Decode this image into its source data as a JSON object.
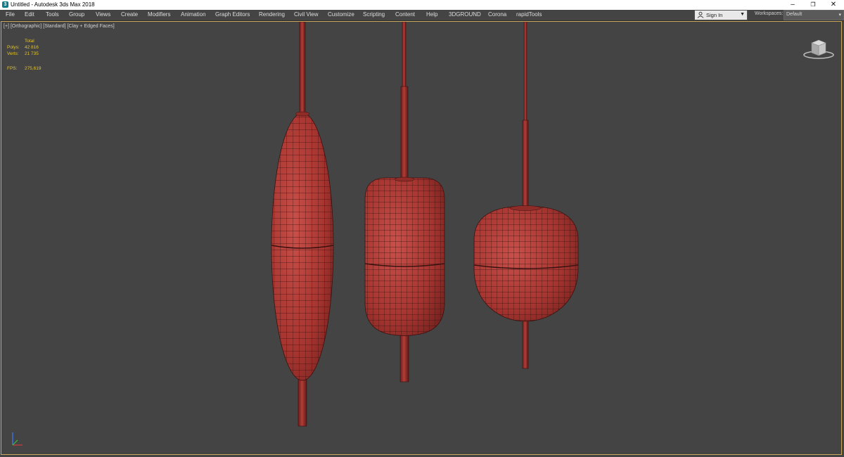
{
  "window": {
    "title": "Untitled - Autodesk 3ds Max 2018",
    "minimize_glyph": "–",
    "maximize_glyph": "❐",
    "close_glyph": "✕"
  },
  "menu": {
    "items": [
      "File",
      "Edit",
      "Tools",
      "Group",
      "Views",
      "Create",
      "Modifiers",
      "Animation",
      "Graph Editors",
      "Rendering",
      "Civil View",
      "Customize",
      "Scripting",
      "Content",
      "Help",
      "3DGROUND",
      "Corona",
      "rapidTools"
    ]
  },
  "account": {
    "signin_label": "Sign In",
    "workspaces_label": "Workspaces:",
    "workspace_value": "Default"
  },
  "viewport": {
    "label_plus": "[+]",
    "label_view": "[Orthographic]",
    "label_shading": "[Standard]",
    "label_style": "[Clay + Edged Faces]",
    "stats": {
      "total_label": "Total",
      "polys_label": "Polys:",
      "polys_value": "42 816",
      "verts_label": "Verts:",
      "verts_value": "21 735",
      "fps_label": "FPS:",
      "fps_value": "275,619"
    }
  },
  "colors": {
    "viewport_bg": "#444444",
    "clay": "#b03a35",
    "wire": "#3a1210",
    "stats_text": "#e3c32b",
    "active_border": "#c9a75a"
  },
  "icons": {
    "app": "3ds-max-logo-icon",
    "viewcube": "viewcube-icon",
    "axis": "axis-tripod-icon",
    "user": "user-icon"
  }
}
